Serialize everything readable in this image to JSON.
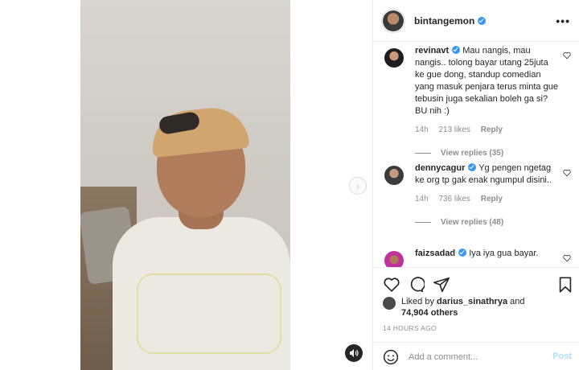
{
  "post": {
    "username": "bintangemon",
    "verified": true
  },
  "comments": [
    {
      "username": "revinavt",
      "text": "Mau nangis, mau nangis.. tolong bayar utang 25juta ke gue dong, standup comedian yang masuk penjara terus minta gue tebusin juga sekalian boleh ga si? BU nih :)",
      "time": "14h",
      "likes": "213 likes",
      "reply_label": "Reply",
      "view_replies": "View replies (35)"
    },
    {
      "username": "dennycagur",
      "text": "Yg pengen ngetag ke org tp gak enak ngumpul disini..",
      "time": "14h",
      "likes": "736 likes",
      "reply_label": "Reply",
      "view_replies": "View replies (48)"
    },
    {
      "username": "faizsadad",
      "text": "Iya iya gua bayar."
    }
  ],
  "likes": {
    "prefix": "Liked by ",
    "user": "darius_sinathrya",
    "middle": " and",
    "count": "74,904 others"
  },
  "timestamp": "14 HOURS AGO",
  "add_comment": {
    "placeholder": "Add a comment...",
    "post_label": "Post"
  },
  "colors": {
    "verified": "#3897f0",
    "post_disabled": "#b2dffc",
    "muted": "#8e8e8e"
  },
  "icons": [
    "next-arrow-icon",
    "sound-icon",
    "more-icon",
    "heart-icon",
    "comment-icon",
    "share-icon",
    "bookmark-icon",
    "emoji-icon"
  ]
}
